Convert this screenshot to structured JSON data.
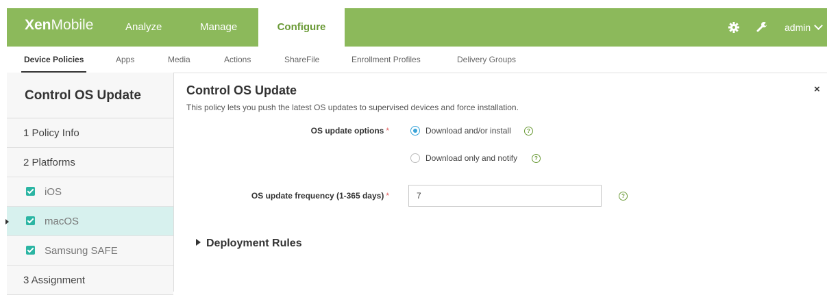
{
  "topbar": {
    "logo_bold": "Xen",
    "logo_light": "Mobile",
    "tabs": [
      "Analyze",
      "Manage",
      "Configure"
    ],
    "user": "admin"
  },
  "subnav": {
    "tabs": [
      "Device Policies",
      "Apps",
      "Media",
      "Actions",
      "ShareFile",
      "Enrollment Profiles",
      "Delivery Groups"
    ]
  },
  "sidebar": {
    "title": "Control OS Update",
    "steps": [
      "1  Policy Info",
      "2  Platforms",
      "3  Assignment"
    ],
    "platforms": [
      "iOS",
      "macOS",
      "Samsung SAFE"
    ]
  },
  "main": {
    "title": "Control OS Update",
    "description": "This policy lets you push the latest OS updates to supervised devices and force installation.",
    "close": "×",
    "update_options_label": "OS update options",
    "option_1": "Download and/or install",
    "option_2": "Download only and notify",
    "frequency_label": "OS update frequency (1-365 days)",
    "frequency_value": "7",
    "required_mark": "*",
    "help_glyph": "?",
    "deployment_rules": "Deployment Rules"
  },
  "colors": {
    "brand_green": "#8cb95b",
    "accent_teal": "#2bb5a3",
    "radio_blue": "#3aa4d8"
  }
}
